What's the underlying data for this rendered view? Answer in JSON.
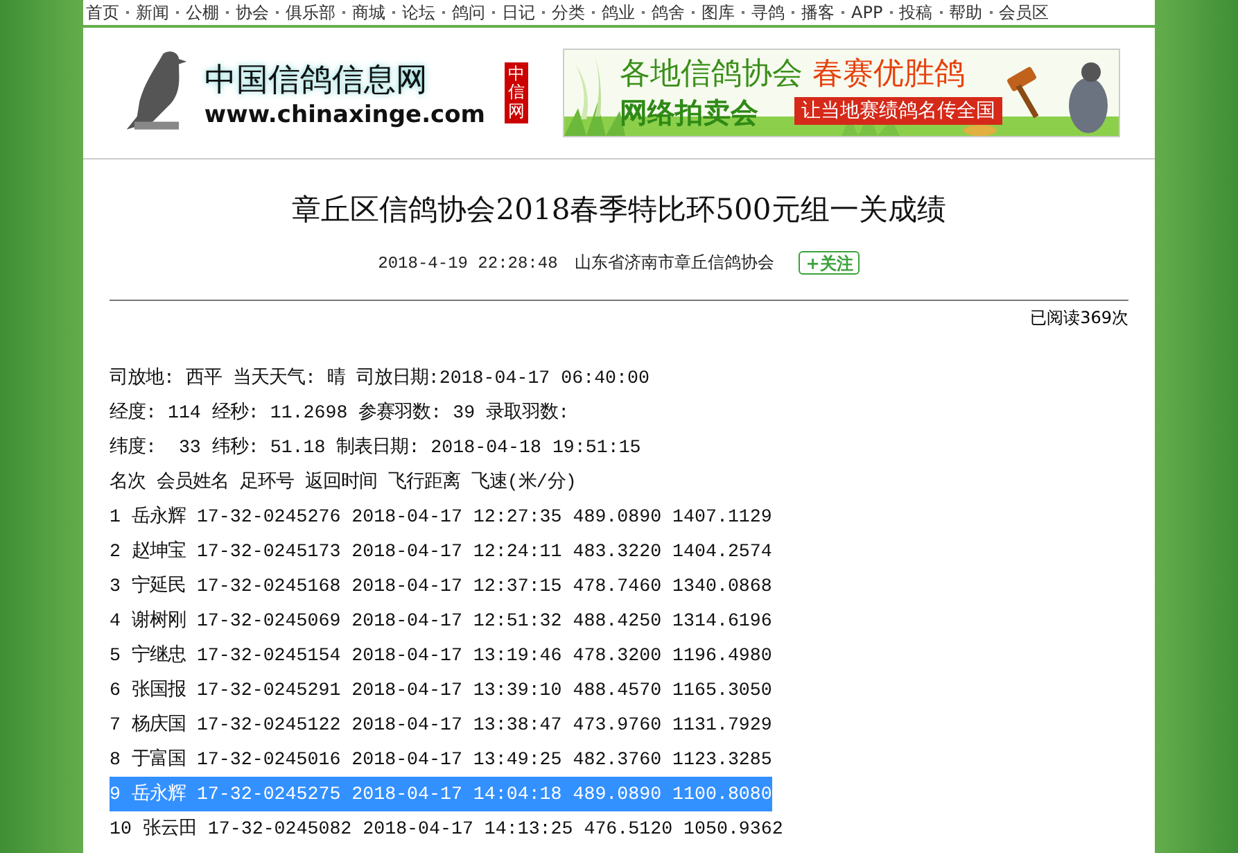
{
  "nav": [
    "首页",
    "新闻",
    "公棚",
    "协会",
    "俱乐部",
    "商城",
    "论坛",
    "鸽问",
    "日记",
    "分类",
    "鸽业",
    "鸽舍",
    "图库",
    "寻鸽",
    "播客",
    "APP",
    "投稿",
    "帮助",
    "会员区"
  ],
  "logo": {
    "title": "中国信鸽信息网",
    "url": "www.chinaxinge.com",
    "badge": "中信网"
  },
  "banner": {
    "line1": "各地信鸽协会",
    "line1_highlight": "春赛优胜鸽",
    "line2": "网络拍卖会",
    "tagline": "让当地赛绩鸽名传全国"
  },
  "article": {
    "title": "章丘区信鸽协会2018春季特比环500元组一关成绩",
    "date": "2018-4-19 22:28:48",
    "source": "山东省济南市章丘信鸽协会",
    "follow_button": "+关注",
    "read_count": "已阅读369次",
    "info_lines": [
      "司放地: 西平 当天天气: 晴 司放日期:2018-04-17 06:40:00",
      "经度: 114 经秒: 11.2698 参赛羽数: 39 录取羽数:",
      "纬度:  33 纬秒: 51.18 制表日期: 2018-04-18 19:51:15"
    ],
    "header": "名次 会员姓名 足环号 返回时间 飞行距离 飞速(米/分)",
    "rows": [
      {
        "text": "1 岳永辉 17-32-0245276 2018-04-17 12:27:35 489.0890 1407.1129",
        "selected": false
      },
      {
        "text": "2 赵坤宝 17-32-0245173 2018-04-17 12:24:11 483.3220 1404.2574",
        "selected": false
      },
      {
        "text": "3 宁延民 17-32-0245168 2018-04-17 12:37:15 478.7460 1340.0868",
        "selected": false
      },
      {
        "text": "4 谢树刚 17-32-0245069 2018-04-17 12:51:32 488.4250 1314.6196",
        "selected": false
      },
      {
        "text": "5 宁继忠 17-32-0245154 2018-04-17 13:19:46 478.3200 1196.4980",
        "selected": false
      },
      {
        "text": "6 张国报 17-32-0245291 2018-04-17 13:39:10 488.4570 1165.3050",
        "selected": false
      },
      {
        "text": "7 杨庆国 17-32-0245122 2018-04-17 13:38:47 473.9760 1131.7929",
        "selected": false
      },
      {
        "text": "8 于富国 17-32-0245016 2018-04-17 13:49:25 482.3760 1123.3285",
        "selected": false
      },
      {
        "text": "9 岳永辉 17-32-0245275 2018-04-17 14:04:18 489.0890 1100.8080",
        "selected": true
      },
      {
        "text": "10 张云田 17-32-0245082 2018-04-17 14:13:25 476.5120 1050.9362",
        "selected": false
      }
    ]
  }
}
